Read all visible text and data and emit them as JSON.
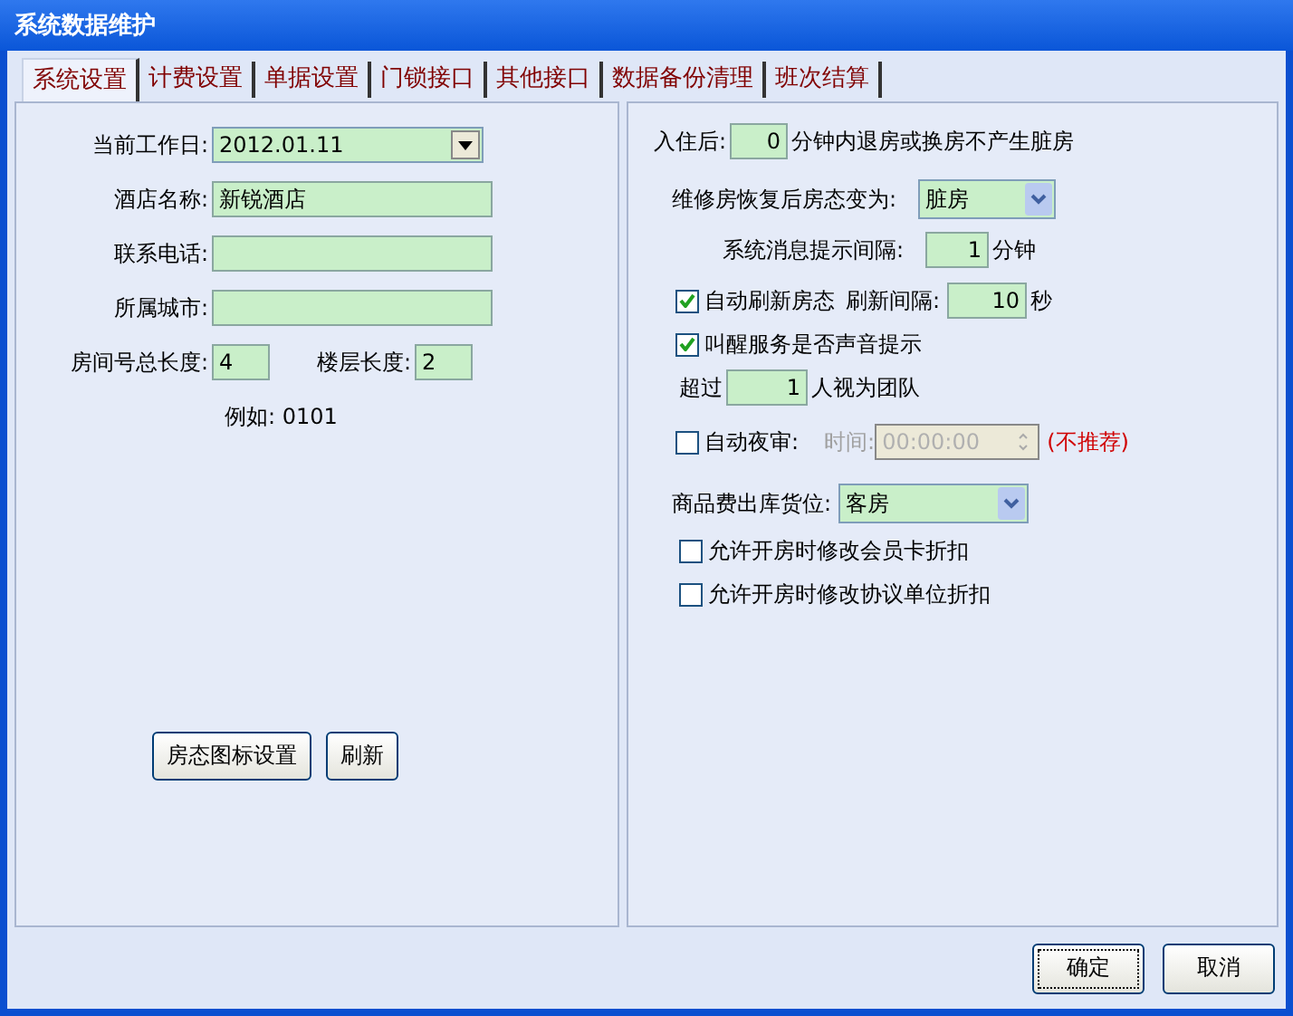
{
  "window": {
    "title": "系统数据维护"
  },
  "tabs": [
    {
      "label": "系统设置",
      "selected": true
    },
    {
      "label": "计费设置",
      "selected": false
    },
    {
      "label": "单据设置",
      "selected": false
    },
    {
      "label": "门锁接口",
      "selected": false
    },
    {
      "label": "其他接口",
      "selected": false
    },
    {
      "label": "数据备份清理",
      "selected": false
    },
    {
      "label": "班次结算",
      "selected": false
    }
  ],
  "left": {
    "date": {
      "label": "当前工作日:",
      "value": "2012.01.11"
    },
    "fields": [
      {
        "label": "酒店名称:",
        "value": "新锐酒店"
      },
      {
        "label": "联系电话:"
      },
      {
        "label": "所属城市:"
      }
    ],
    "room_length": {
      "label": "房间号总长度:",
      "value": "4"
    },
    "floor_length": {
      "label": "楼层长度:",
      "value": "2"
    },
    "example": "例如: 0101",
    "buttons": [
      "房态图标设置",
      "刷新"
    ]
  },
  "right": {
    "rows": [
      {
        "parts": [
          {
            "kind": "label",
            "text": "入住后:"
          },
          {
            "kind": "input",
            "value": "0"
          },
          {
            "kind": "label",
            "text": "分钟内退房或换房不产生脏房"
          }
        ]
      },
      {
        "parts": [
          {
            "kind": "label",
            "text": "维修房恢复后房态变为:"
          },
          {
            "kind": "select",
            "value": "脏房"
          }
        ]
      },
      {
        "parts": [
          {
            "kind": "label",
            "text": "系统消息提示间隔:"
          },
          {
            "kind": "input",
            "value": "1"
          },
          {
            "kind": "label",
            "text": "分钟"
          }
        ]
      },
      {
        "parts": [
          {
            "kind": "checkbox",
            "text": "自动刷新房态",
            "checked": true
          },
          {
            "kind": "label",
            "text": "刷新间隔:"
          },
          {
            "kind": "input",
            "value": "10"
          },
          {
            "kind": "label",
            "text": "秒"
          }
        ]
      },
      {
        "parts": [
          {
            "kind": "checkbox",
            "text": "叫醒服务是否声音提示",
            "checked": true
          }
        ]
      },
      {
        "parts": [
          {
            "kind": "label",
            "text": "超过"
          },
          {
            "kind": "input",
            "value": "1"
          },
          {
            "kind": "label",
            "text": "人视为团队"
          }
        ]
      },
      {
        "parts": [
          {
            "kind": "checkbox",
            "text": "自动夜审:",
            "checked": false
          },
          {
            "kind": "time",
            "label": "时间:",
            "value": "00:00:00",
            "disabled": true
          },
          {
            "kind": "note",
            "text": "(不推荐)"
          }
        ]
      },
      {
        "parts": [
          {
            "kind": "label",
            "text": "商品费出库货位:"
          },
          {
            "kind": "select",
            "value": "客房"
          }
        ]
      },
      {
        "parts": [
          {
            "kind": "checkbox",
            "text": "允许开房时修改会员卡折扣",
            "checked": false
          }
        ]
      },
      {
        "parts": [
          {
            "kind": "checkbox",
            "text": "允许开房时修改协议单位折扣",
            "checked": false
          }
        ]
      }
    ]
  },
  "buttons": [
    {
      "label": "确定",
      "focused": true
    },
    {
      "label": "取消",
      "focused": false
    }
  ]
}
